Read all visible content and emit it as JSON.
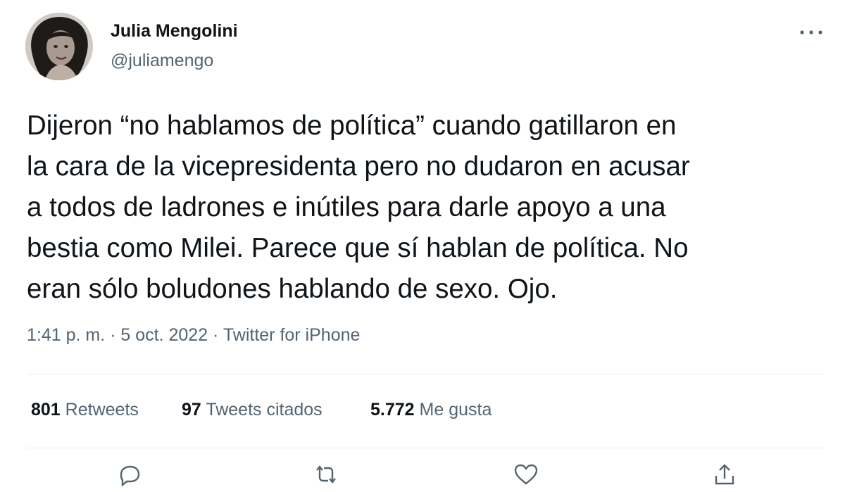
{
  "user": {
    "name": "Julia Mengolini",
    "handle": "@juliamengo"
  },
  "tweet": {
    "lines": [
      "Dijeron “no hablamos de política” cuando gatillaron en",
      "la cara de la vicepresidenta pero no dudaron en acusar",
      "a todos de ladrones e inútiles para darle apoyo a una",
      "bestia como Milei. Parece que sí hablan de política. No",
      "eran sólo boludones hablando de sexo. Ojo."
    ]
  },
  "meta": {
    "time": "1:41 p. m.",
    "sep1": " · ",
    "date": "5 oct. 2022",
    "sep2": " · ",
    "source": "Twitter for iPhone"
  },
  "stats": {
    "retweets": {
      "count": "801",
      "label": "Retweets"
    },
    "quotes": {
      "count": "97",
      "label": "Tweets citados"
    },
    "likes": {
      "count": "5.772",
      "label": "Me gusta"
    }
  },
  "icons": {
    "more": "more-dots-icon",
    "reply": "reply-icon",
    "retweet": "retweet-icon",
    "like": "like-icon",
    "share": "share-icon"
  },
  "colors": {
    "text": "#0f1419",
    "secondary": "#536471",
    "divider": "#e6ecf0"
  }
}
